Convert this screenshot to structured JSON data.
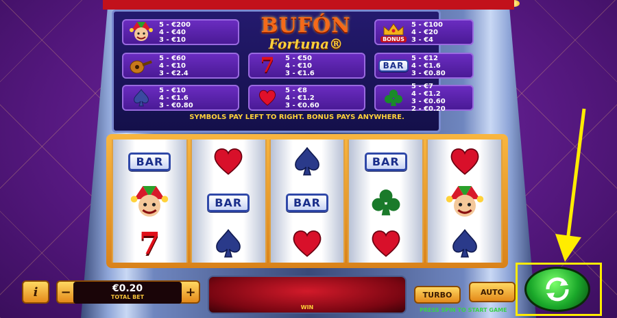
{
  "game": {
    "logo_line1": "BUFÓN",
    "logo_line2": "Fortuna®",
    "note": "SYMBOLS PAY LEFT TO RIGHT. BONUS PAYS ANYWHERE.",
    "bonus_label": "BONUS"
  },
  "paytable": [
    {
      "symbol": "jester-icon",
      "pays": [
        "5 - €200",
        "4 - €40",
        "3 - €10"
      ]
    },
    {
      "symbol": "crown-bonus-icon",
      "pays": [
        "5 - €100",
        "4 - €20",
        "3 - €4"
      ]
    },
    {
      "symbol": "mandolin-icon",
      "pays": [
        "5 - €60",
        "4 - €10",
        "3 - €2.4"
      ]
    },
    {
      "symbol": "seven-icon",
      "pays": [
        "5 - €50",
        "4 - €10",
        "3 - €1.6"
      ]
    },
    {
      "symbol": "bar-icon",
      "pays": [
        "5 - €12",
        "4 - €1.6",
        "3 - €0.80"
      ]
    },
    {
      "symbol": "spade-icon",
      "pays": [
        "5 - €10",
        "4 - €1.6",
        "3 - €0.80"
      ]
    },
    {
      "symbol": "heart-icon",
      "pays": [
        "5 - €8",
        "4 - €1.2",
        "3 - €0.60"
      ]
    },
    {
      "symbol": "club-icon",
      "pays": [
        "5 - €7",
        "4 - €1.2",
        "3 - €0.60",
        "2 - €0.20"
      ]
    }
  ],
  "reels": [
    [
      "bar",
      "jester",
      "seven"
    ],
    [
      "heart",
      "bar",
      "spade"
    ],
    [
      "spade",
      "bar",
      "heart"
    ],
    [
      "bar",
      "club",
      "heart"
    ],
    [
      "heart",
      "jester",
      "spade"
    ]
  ],
  "bar_text": "BAR",
  "seven_text": "7",
  "controls": {
    "info_label": "i",
    "minus_label": "−",
    "plus_label": "+",
    "bet_value": "€0.20",
    "bet_label": "TOTAL BET",
    "win_label": "WIN",
    "turbo_label": "TURBO",
    "auto_label": "AUTO",
    "press_spin": "PRESS SPIN TO START GAME"
  },
  "colors": {
    "accent": "#ffec00",
    "bar_blue": "#2f48a8",
    "heart_red": "#d8102a",
    "spade_blue": "#2a3a8a",
    "club_green": "#1a7a2a"
  }
}
